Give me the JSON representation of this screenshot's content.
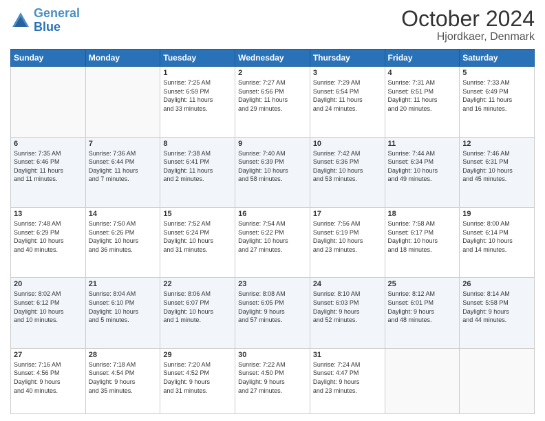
{
  "header": {
    "logo_line1": "General",
    "logo_line2": "Blue",
    "month": "October 2024",
    "location": "Hjordkaer, Denmark"
  },
  "weekdays": [
    "Sunday",
    "Monday",
    "Tuesday",
    "Wednesday",
    "Thursday",
    "Friday",
    "Saturday"
  ],
  "weeks": [
    [
      {
        "day": "",
        "info": ""
      },
      {
        "day": "",
        "info": ""
      },
      {
        "day": "1",
        "info": "Sunrise: 7:25 AM\nSunset: 6:59 PM\nDaylight: 11 hours\nand 33 minutes."
      },
      {
        "day": "2",
        "info": "Sunrise: 7:27 AM\nSunset: 6:56 PM\nDaylight: 11 hours\nand 29 minutes."
      },
      {
        "day": "3",
        "info": "Sunrise: 7:29 AM\nSunset: 6:54 PM\nDaylight: 11 hours\nand 24 minutes."
      },
      {
        "day": "4",
        "info": "Sunrise: 7:31 AM\nSunset: 6:51 PM\nDaylight: 11 hours\nand 20 minutes."
      },
      {
        "day": "5",
        "info": "Sunrise: 7:33 AM\nSunset: 6:49 PM\nDaylight: 11 hours\nand 16 minutes."
      }
    ],
    [
      {
        "day": "6",
        "info": "Sunrise: 7:35 AM\nSunset: 6:46 PM\nDaylight: 11 hours\nand 11 minutes."
      },
      {
        "day": "7",
        "info": "Sunrise: 7:36 AM\nSunset: 6:44 PM\nDaylight: 11 hours\nand 7 minutes."
      },
      {
        "day": "8",
        "info": "Sunrise: 7:38 AM\nSunset: 6:41 PM\nDaylight: 11 hours\nand 2 minutes."
      },
      {
        "day": "9",
        "info": "Sunrise: 7:40 AM\nSunset: 6:39 PM\nDaylight: 10 hours\nand 58 minutes."
      },
      {
        "day": "10",
        "info": "Sunrise: 7:42 AM\nSunset: 6:36 PM\nDaylight: 10 hours\nand 53 minutes."
      },
      {
        "day": "11",
        "info": "Sunrise: 7:44 AM\nSunset: 6:34 PM\nDaylight: 10 hours\nand 49 minutes."
      },
      {
        "day": "12",
        "info": "Sunrise: 7:46 AM\nSunset: 6:31 PM\nDaylight: 10 hours\nand 45 minutes."
      }
    ],
    [
      {
        "day": "13",
        "info": "Sunrise: 7:48 AM\nSunset: 6:29 PM\nDaylight: 10 hours\nand 40 minutes."
      },
      {
        "day": "14",
        "info": "Sunrise: 7:50 AM\nSunset: 6:26 PM\nDaylight: 10 hours\nand 36 minutes."
      },
      {
        "day": "15",
        "info": "Sunrise: 7:52 AM\nSunset: 6:24 PM\nDaylight: 10 hours\nand 31 minutes."
      },
      {
        "day": "16",
        "info": "Sunrise: 7:54 AM\nSunset: 6:22 PM\nDaylight: 10 hours\nand 27 minutes."
      },
      {
        "day": "17",
        "info": "Sunrise: 7:56 AM\nSunset: 6:19 PM\nDaylight: 10 hours\nand 23 minutes."
      },
      {
        "day": "18",
        "info": "Sunrise: 7:58 AM\nSunset: 6:17 PM\nDaylight: 10 hours\nand 18 minutes."
      },
      {
        "day": "19",
        "info": "Sunrise: 8:00 AM\nSunset: 6:14 PM\nDaylight: 10 hours\nand 14 minutes."
      }
    ],
    [
      {
        "day": "20",
        "info": "Sunrise: 8:02 AM\nSunset: 6:12 PM\nDaylight: 10 hours\nand 10 minutes."
      },
      {
        "day": "21",
        "info": "Sunrise: 8:04 AM\nSunset: 6:10 PM\nDaylight: 10 hours\nand 5 minutes."
      },
      {
        "day": "22",
        "info": "Sunrise: 8:06 AM\nSunset: 6:07 PM\nDaylight: 10 hours\nand 1 minute."
      },
      {
        "day": "23",
        "info": "Sunrise: 8:08 AM\nSunset: 6:05 PM\nDaylight: 9 hours\nand 57 minutes."
      },
      {
        "day": "24",
        "info": "Sunrise: 8:10 AM\nSunset: 6:03 PM\nDaylight: 9 hours\nand 52 minutes."
      },
      {
        "day": "25",
        "info": "Sunrise: 8:12 AM\nSunset: 6:01 PM\nDaylight: 9 hours\nand 48 minutes."
      },
      {
        "day": "26",
        "info": "Sunrise: 8:14 AM\nSunset: 5:58 PM\nDaylight: 9 hours\nand 44 minutes."
      }
    ],
    [
      {
        "day": "27",
        "info": "Sunrise: 7:16 AM\nSunset: 4:56 PM\nDaylight: 9 hours\nand 40 minutes."
      },
      {
        "day": "28",
        "info": "Sunrise: 7:18 AM\nSunset: 4:54 PM\nDaylight: 9 hours\nand 35 minutes."
      },
      {
        "day": "29",
        "info": "Sunrise: 7:20 AM\nSunset: 4:52 PM\nDaylight: 9 hours\nand 31 minutes."
      },
      {
        "day": "30",
        "info": "Sunrise: 7:22 AM\nSunset: 4:50 PM\nDaylight: 9 hours\nand 27 minutes."
      },
      {
        "day": "31",
        "info": "Sunrise: 7:24 AM\nSunset: 4:47 PM\nDaylight: 9 hours\nand 23 minutes."
      },
      {
        "day": "",
        "info": ""
      },
      {
        "day": "",
        "info": ""
      }
    ]
  ]
}
